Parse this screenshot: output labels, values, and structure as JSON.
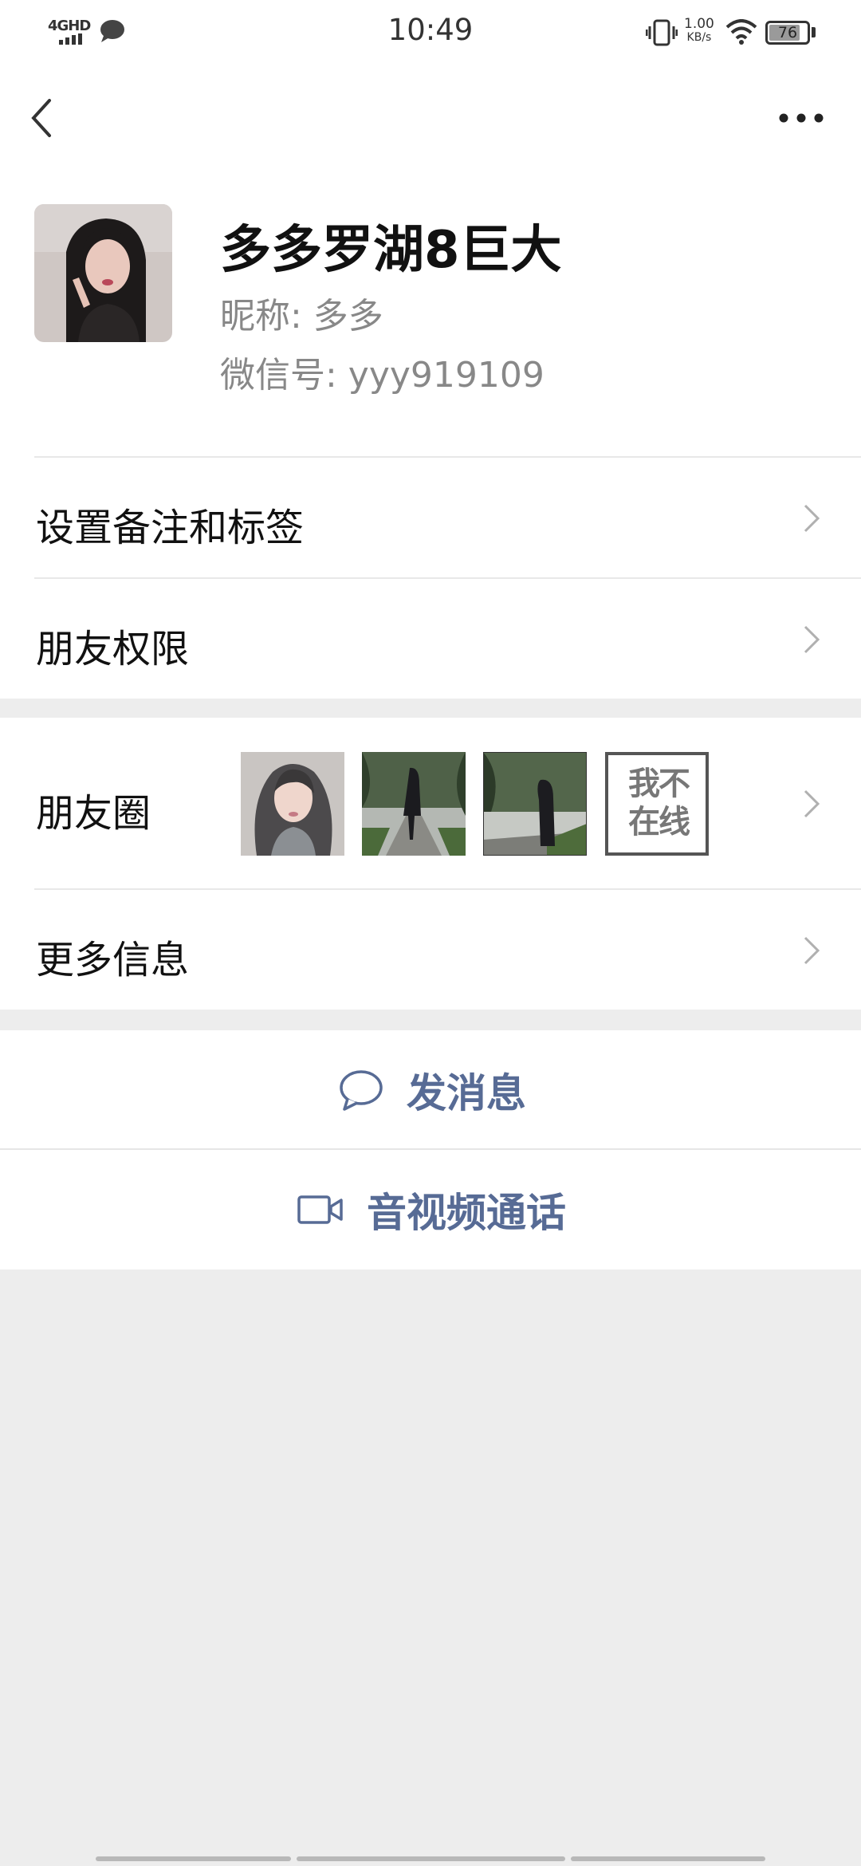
{
  "status_bar": {
    "time": "10:49",
    "network": "4GHD",
    "speed_value": "1.00",
    "speed_unit": "KB/s",
    "battery": "76"
  },
  "header": {
    "back_icon": "chevron-left-icon",
    "more_icon": "ellipsis-icon"
  },
  "profile": {
    "name": "多多罗湖8巨大",
    "nickname_label": "昵称:  多多",
    "wechat_id_label": "微信号:  yyy919109"
  },
  "rows": {
    "remark_tags": "设置备注和标签",
    "friend_permissions": "朋友权限",
    "moments": "朋友圈",
    "more_info": "更多信息"
  },
  "moments_offline_sticker": "我不\n在线",
  "actions": {
    "send_message": "发消息",
    "video_call": "音视频通话"
  },
  "colors": {
    "accent": "#576b95",
    "background": "#ededed",
    "card": "#ffffff"
  }
}
